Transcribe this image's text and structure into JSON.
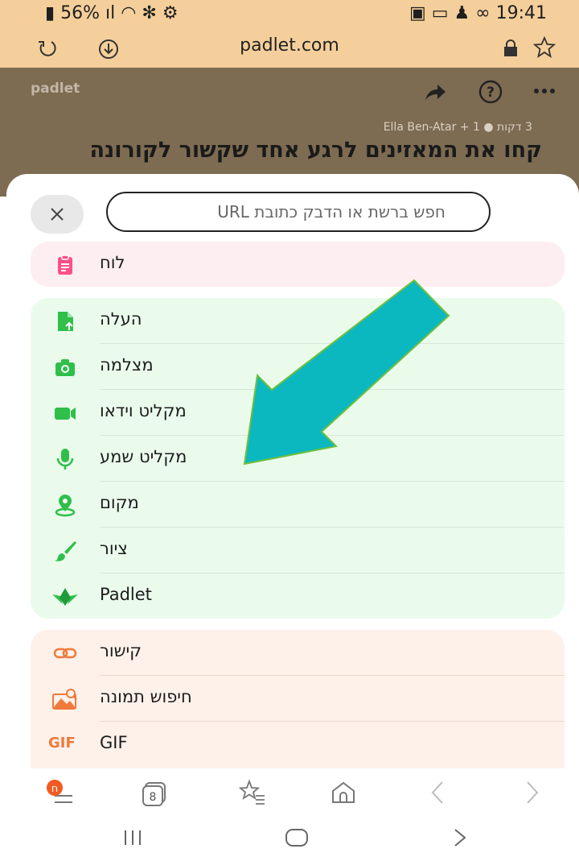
{
  "status_bar": {
    "battery": "56%",
    "time": "19:41"
  },
  "browser": {
    "url": "padlet.com"
  },
  "page": {
    "brand": "padlet",
    "meta": "3 דקות ● 1 + Ella Ben-Atar",
    "title": "קחו את המאזינים לרגע אחד שקשור לקורונה"
  },
  "sheet": {
    "search_placeholder": "חפש ברשת או הדבק כתובת URL",
    "groups": [
      {
        "name": "board",
        "items": [
          {
            "label": "לוח",
            "icon": "clipboard-icon"
          }
        ]
      },
      {
        "name": "media",
        "items": [
          {
            "label": "העלה",
            "icon": "upload-file-icon"
          },
          {
            "label": "מצלמה",
            "icon": "camera-icon"
          },
          {
            "label": "מקליט וידאו",
            "icon": "video-camera-icon"
          },
          {
            "label": "מקליט שמע",
            "icon": "microphone-icon"
          },
          {
            "label": "מקום",
            "icon": "location-pin-icon"
          },
          {
            "label": "ציור",
            "icon": "brush-icon"
          },
          {
            "label": "Padlet",
            "icon": "padlet-bird-icon"
          }
        ]
      },
      {
        "name": "web",
        "items": [
          {
            "label": "קישור",
            "icon": "link-icon"
          },
          {
            "label": "חיפוש תמונה",
            "icon": "image-search-icon"
          },
          {
            "label": "GIF",
            "icon": "gif-icon"
          }
        ]
      }
    ]
  },
  "bottom_nav": {
    "tabs_count": "8",
    "menu_badge": "ח"
  },
  "colors": {
    "status_bg": "#f5cf9b",
    "pink_group": "#fdeef1",
    "green_group": "#eafbec",
    "peach_group": "#fdf1ea",
    "arrow_fill": "#0cb8c0",
    "icon_green": "#2fbf4a",
    "icon_pink": "#ff4f8a",
    "icon_orange": "#f07a3a"
  }
}
